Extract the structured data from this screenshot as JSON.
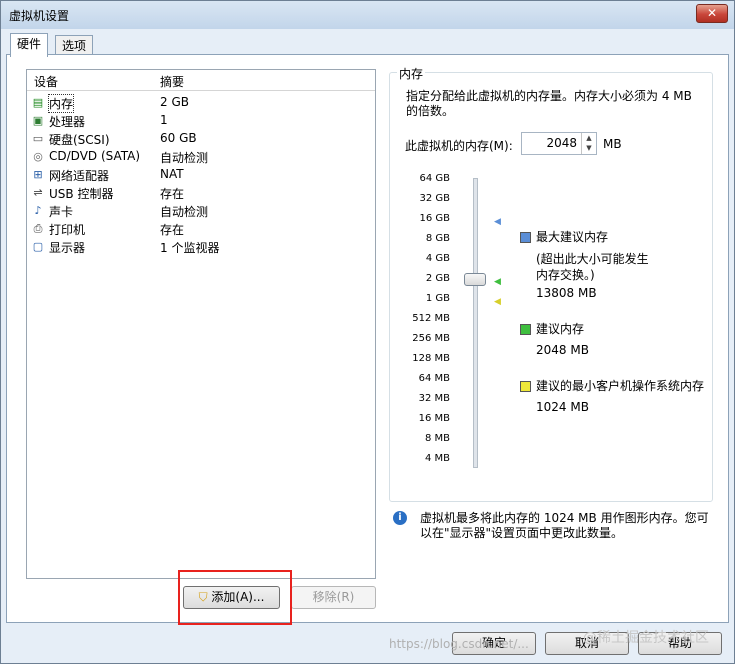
{
  "window": {
    "title": "虚拟机设置",
    "close_glyph": "✕"
  },
  "tabs": [
    {
      "label": "硬件",
      "active": true
    },
    {
      "label": "选项",
      "active": false
    }
  ],
  "device_list": {
    "columns": [
      "设备",
      "摘要"
    ],
    "rows": [
      {
        "icon": "memory-icon",
        "glyph": "▤",
        "name": "内存",
        "summary": "2 GB",
        "selected": true
      },
      {
        "icon": "processor-icon",
        "glyph": "▣",
        "name": "处理器",
        "summary": "1"
      },
      {
        "icon": "hard-disk-icon",
        "glyph": "▭",
        "name": "硬盘(SCSI)",
        "summary": "60 GB"
      },
      {
        "icon": "cd-dvd-icon",
        "glyph": "◎",
        "name": "CD/DVD (SATA)",
        "summary": "自动检测"
      },
      {
        "icon": "network-adapter-icon",
        "glyph": "⊞",
        "name": "网络适配器",
        "summary": "NAT"
      },
      {
        "icon": "usb-icon",
        "glyph": "⇌",
        "name": "USB 控制器",
        "summary": "存在"
      },
      {
        "icon": "sound-card-icon",
        "glyph": "♪",
        "name": "声卡",
        "summary": "自动检测"
      },
      {
        "icon": "printer-icon",
        "glyph": "⎙",
        "name": "打印机",
        "summary": "存在"
      },
      {
        "icon": "display-icon",
        "glyph": "▢",
        "name": "显示器",
        "summary": "1 个监视器"
      }
    ]
  },
  "buttons": {
    "add": "添加(A)...",
    "remove": "移除(R)",
    "ok": "确定",
    "cancel": "取消",
    "help": "帮助"
  },
  "memory": {
    "group_title": "内存",
    "description": "指定分配给此虚拟机的内存量。内存大小必须为 4 MB 的倍数。",
    "label": "此虚拟机的内存(M):",
    "value": "2048",
    "unit": "MB",
    "ticks": [
      "64 GB",
      "32 GB",
      "16 GB",
      "8 GB",
      "4 GB",
      "2 GB",
      "1 GB",
      "512 MB",
      "256 MB",
      "128 MB",
      "64 MB",
      "32 MB",
      "16 MB",
      "8 MB",
      "4 MB"
    ],
    "slider_value": "2 GB",
    "legend": [
      {
        "color": "#5b8ed6",
        "title": "最大建议内存",
        "note": "(超出此大小可能发生内存交换。)",
        "value": "13808 MB"
      },
      {
        "color": "#3fbf3f",
        "title": "建议内存",
        "value": "2048 MB"
      },
      {
        "color": "#efe83a",
        "title": "建议的最小客户机操作系统内存",
        "value": "1024 MB"
      }
    ]
  },
  "info": {
    "text": "虚拟机最多将此内存的 1024 MB 用作图形内存。您可以在\"显示器\"设置页面中更改此数量。"
  },
  "watermark": {
    "text": "https://blog.csdn.net/...",
    "brand": "@稀土掘金技术社区"
  }
}
